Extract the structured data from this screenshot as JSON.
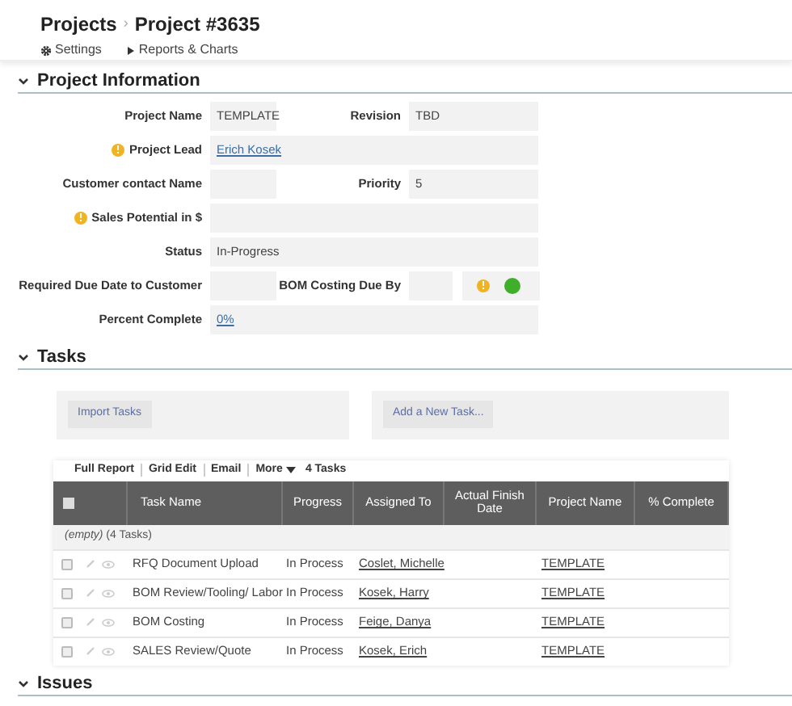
{
  "breadcrumb": {
    "items": [
      "Projects",
      "Project #3635"
    ],
    "separator": "›"
  },
  "header_links": {
    "settings": "Settings",
    "reports": "Reports & Charts"
  },
  "project_information": {
    "title": "Project Information",
    "expanded": true,
    "rows": [
      {
        "left": {
          "label": "Project Name",
          "warning": false,
          "value": "TEMPLATE",
          "kind": "text"
        },
        "right": {
          "label": "Revision",
          "value": "TBD",
          "kind": "text"
        }
      },
      {
        "left": {
          "label": "Project Lead",
          "warning": true,
          "value": "Erich Kosek",
          "kind": "link"
        }
      },
      {
        "left": {
          "label": "Customer contact Name",
          "warning": false,
          "kind": "text"
        },
        "right": {
          "label": "Priority",
          "value": "5",
          "kind": "text"
        }
      },
      {
        "left": {
          "label": "Sales Potential in $",
          "warning": true,
          "kind": "text"
        }
      },
      {
        "left": {
          "label": "Status",
          "warning": false,
          "value": "In-Progress",
          "kind": "text"
        }
      },
      {
        "left": {
          "label": "Required Due Date to Customer",
          "warning": false,
          "kind": "text"
        },
        "right": {
          "label": "BOM Costing Due By",
          "kind": "date",
          "warning": true,
          "color": "#3fae2a"
        }
      },
      {
        "left": {
          "label": "Percent Complete",
          "warning": false,
          "value": "0%",
          "kind": "link"
        }
      }
    ]
  },
  "tasks": {
    "title": "Tasks",
    "expanded": true,
    "buttons": [
      "Import Tasks",
      "Add a New Task..."
    ],
    "toolbar": [
      "Full Report",
      "Grid Edit",
      "Email",
      "More"
    ],
    "count": "4 Tasks",
    "select_all_checked": false,
    "columns": [
      "Task Name",
      "Progress",
      "Assigned To",
      "Actual Finish Date",
      "Project Name",
      "% Complete"
    ],
    "group": "*(empty)* (4 Tasks)",
    "rows": [
      {
        "checked": false,
        "task": "RFQ Document Upload",
        "progress": "In Process",
        "assigned": "Coslet, Michelle",
        "project": "TEMPLATE"
      },
      {
        "checked": false,
        "task": "BOM Review/Tooling/ Labor",
        "progress": "In Process",
        "assigned": "Kosek, Harry",
        "project": "TEMPLATE"
      },
      {
        "checked": false,
        "task": "BOM Costing",
        "progress": "In Process",
        "assigned": "Feige, Danya",
        "project": "TEMPLATE"
      },
      {
        "checked": false,
        "task": "SALES Review/Quote",
        "progress": "In Process",
        "assigned": "Kosek, Erich",
        "project": "TEMPLATE"
      }
    ]
  },
  "issues": {
    "title": "Issues",
    "expanded": true
  }
}
